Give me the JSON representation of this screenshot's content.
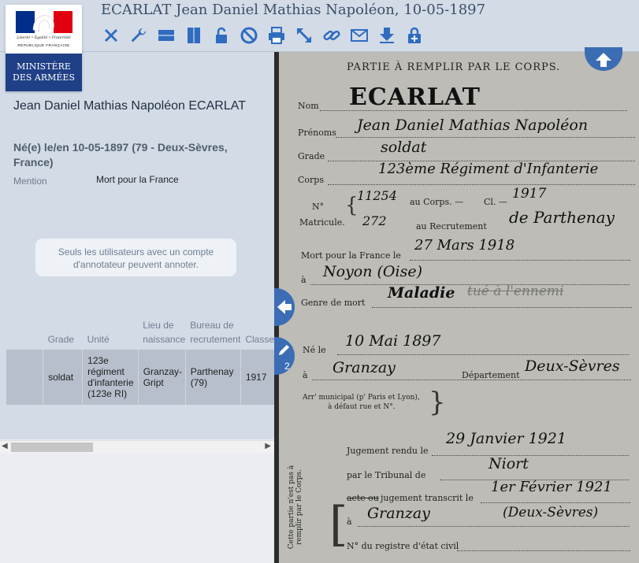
{
  "header": {
    "title": "ECARLAT Jean Daniel Mathias Napoléon, 10-05-1897",
    "tools": [
      {
        "icon": "close-icon"
      },
      {
        "icon": "wrench-icon"
      },
      {
        "icon": "panel-horizontal-icon"
      },
      {
        "icon": "panel-vertical-icon"
      },
      {
        "icon": "lock-icon"
      },
      {
        "icon": "forbidden-icon"
      },
      {
        "icon": "print-icon"
      },
      {
        "icon": "expand-icon"
      },
      {
        "icon": "link-icon"
      },
      {
        "icon": "mail-icon"
      },
      {
        "icon": "download-icon"
      },
      {
        "icon": "lock-add-icon"
      }
    ],
    "accent": "#2f6cc0",
    "background": "#d3dbe6"
  },
  "logo": {
    "motto": "Liberté • Égalité • Fraternité",
    "republic": "RÉPUBLIQUE FRANÇAISE",
    "line1": "MINISTÈRE",
    "line2": "DES ARMÉES"
  },
  "person": {
    "name": "Jean Daniel Mathias Napoléon ECARLAT",
    "birth": "Né(e) le/en 10-05-1897 (79 - Deux-Sèvres, France)",
    "mention_label": "Mention",
    "mention_value": "Mort pour la France"
  },
  "notice": "Seuls les utilisateurs avec un compte d'annotateur peuvent annoter.",
  "table": {
    "headers": [
      "",
      "Grade",
      "Unité",
      "Lieu de naissance",
      "Bureau de recrutement",
      "Classe"
    ],
    "rows": [
      [
        "",
        "soldat",
        "123e régiment d'infanterie (123e RI)",
        "Granzay-Gript",
        "Parthenay (79)",
        "1917"
      ]
    ]
  },
  "annotations": {
    "count": "2"
  },
  "document": {
    "header": "PARTIE À REMPLIR PAR LE CORPS.",
    "name_label": "Nom",
    "name_value": "ECARLAT",
    "prenoms_label": "Prénoms",
    "prenoms_value": "Jean Daniel Mathias Napoléon",
    "grade_label": "Grade",
    "grade_value": "soldat",
    "corps_label": "Corps",
    "corps_value": "123ème Régiment d'Infanterie",
    "no_label": "N°",
    "matricule_label": "Matricule.",
    "corps_no": "11254",
    "au_corps": "au Corps. —",
    "cl": "Cl. —",
    "cl_value": "1917",
    "recrut_no": "272",
    "au_recrut": "au Recrutement",
    "recrut_value": "de Parthenay",
    "mort_label": "Mort pour la France le",
    "mort_value": "27 Mars 1918",
    "a_label": "à",
    "mort_lieu": "Noyon (Oise)",
    "genre_label": "Genre de mort",
    "genre_value": "Maladie",
    "genre_struck": "tué à l'ennemi",
    "ne_label": "Né le",
    "ne_value": "10 Mai 1897",
    "ne_lieu": "Granzay",
    "dept_label": "Département",
    "dept_value": "Deux-Sèvres",
    "arr_label": "Arr' municipal (p' Paris et Lyon),",
    "arr_label2": "à défaut rue et N°.",
    "side_note": "Cette partie n'est pas à remplir par le Corps.",
    "jugement_label": "Jugement rendu le",
    "jugement_value": "29 Janvier 1921",
    "tribunal_label": "par le Tribunal de",
    "tribunal_value": "Niort",
    "transcrit_label": "jugement transcrit le",
    "transcrit_struck": "acte ou",
    "transcrit_value": "1er Février 1921",
    "transcrit_lieu": "Granzay",
    "transcrit_dept": "(Deux-Sèvres)",
    "registre_label": "N° du registre d'état civil"
  }
}
